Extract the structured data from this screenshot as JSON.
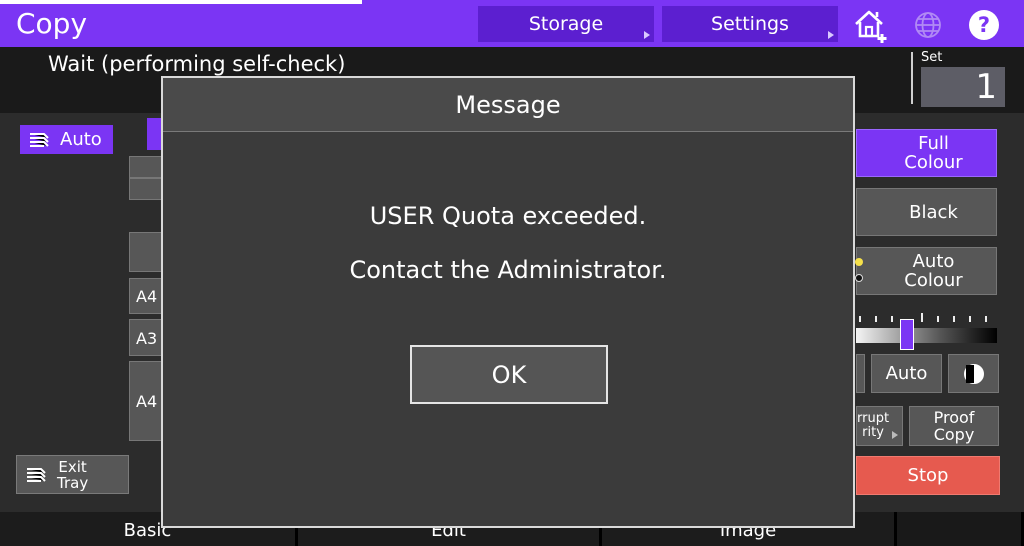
{
  "header": {
    "title": "Copy",
    "buttons": {
      "storage": "Storage",
      "settings": "Settings"
    },
    "icons": [
      "home-add-icon",
      "globe-icon",
      "help-icon"
    ],
    "accent_color": "#7b35f4"
  },
  "status": {
    "message": "Wait (performing self-check)",
    "set_label": "Set",
    "set_value": "1"
  },
  "left_panel": {
    "auto_label": "Auto",
    "paper_sizes": [
      "A4",
      "A3",
      "A4"
    ],
    "exit_tray_label": "Exit\nTray"
  },
  "right_panel": {
    "full_colour": "Full\nColour",
    "black": "Black",
    "auto_colour": "Auto\nColour",
    "density_auto": "Auto",
    "interrupt_partial": "rrupt\nrity",
    "proof_copy": "Proof\nCopy",
    "stop": "Stop",
    "stop_color": "#e65a4f"
  },
  "tabs": [
    "Basic",
    "Edit",
    "Image"
  ],
  "dialog": {
    "title": "Message",
    "line1": "USER Quota exceeded.",
    "line2": "Contact the Administrator.",
    "ok_label": "OK"
  }
}
